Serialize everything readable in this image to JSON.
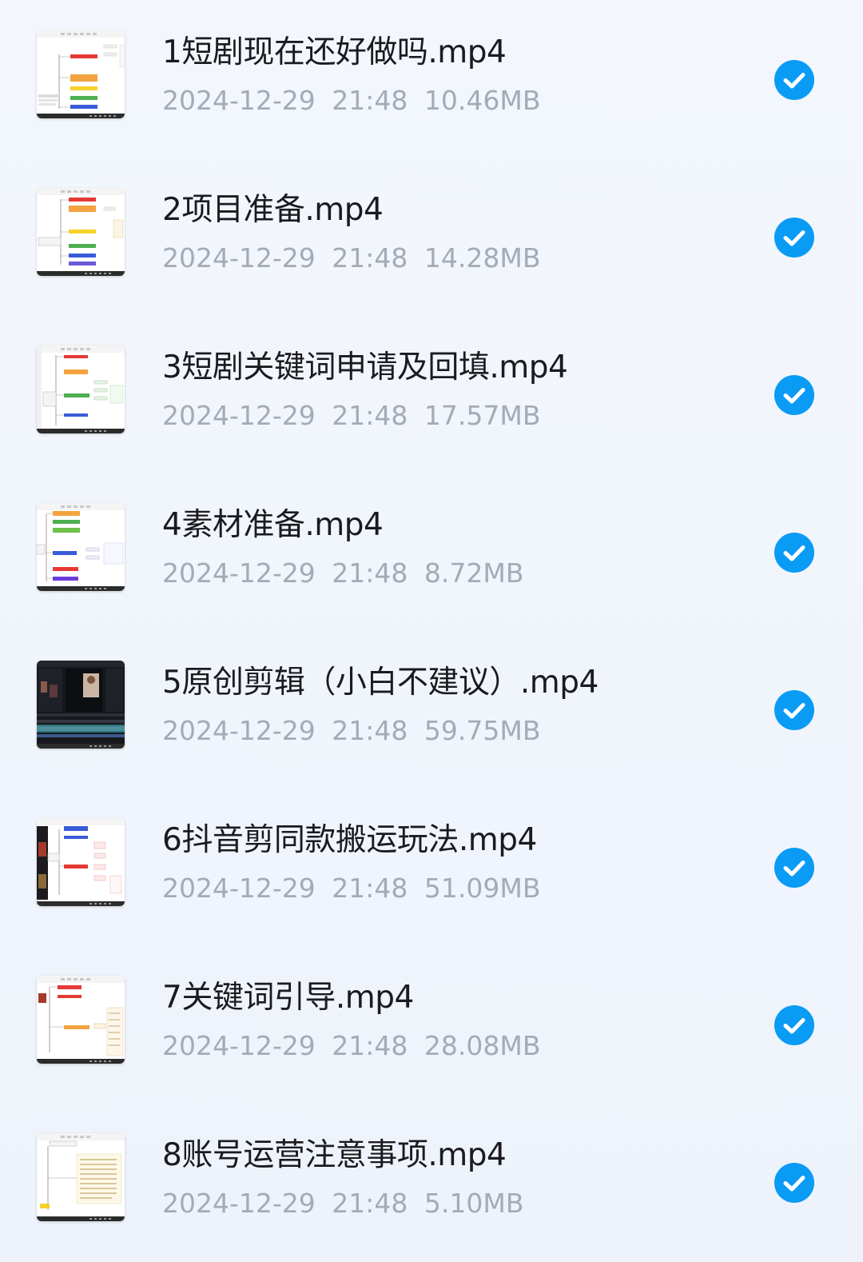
{
  "files": [
    {
      "name": "1短剧现在还好做吗.mp4",
      "date": "2024-12-29",
      "time": "21:48",
      "size": "10.46MB",
      "thumb": "mindmap"
    },
    {
      "name": "2项目准备.mp4",
      "date": "2024-12-29",
      "time": "21:48",
      "size": "14.28MB",
      "thumb": "mindmap"
    },
    {
      "name": "3短剧关键词申请及回填.mp4",
      "date": "2024-12-29",
      "time": "21:48",
      "size": "17.57MB",
      "thumb": "mindmap"
    },
    {
      "name": "4素材准备.mp4",
      "date": "2024-12-29",
      "time": "21:48",
      "size": "8.72MB",
      "thumb": "mindmap"
    },
    {
      "name": "5原创剪辑（小白不建议）.mp4",
      "date": "2024-12-29",
      "time": "21:48",
      "size": "59.75MB",
      "thumb": "editor-dark"
    },
    {
      "name": "6抖音剪同款搬运玩法.mp4",
      "date": "2024-12-29",
      "time": "21:48",
      "size": "51.09MB",
      "thumb": "mindmap"
    },
    {
      "name": "7关键词引导.mp4",
      "date": "2024-12-29",
      "time": "21:48",
      "size": "28.08MB",
      "thumb": "mindmap"
    },
    {
      "name": "8账号运营注意事项.mp4",
      "date": "2024-12-29",
      "time": "21:48",
      "size": "5.10MB",
      "thumb": "mindmap-notes"
    }
  ],
  "selection_icon": "check-circle-icon",
  "colors": {
    "background": "#f1f5fc",
    "check": "#0a9bf5",
    "title": "#1b1b1f",
    "meta": "#a4abb6"
  }
}
